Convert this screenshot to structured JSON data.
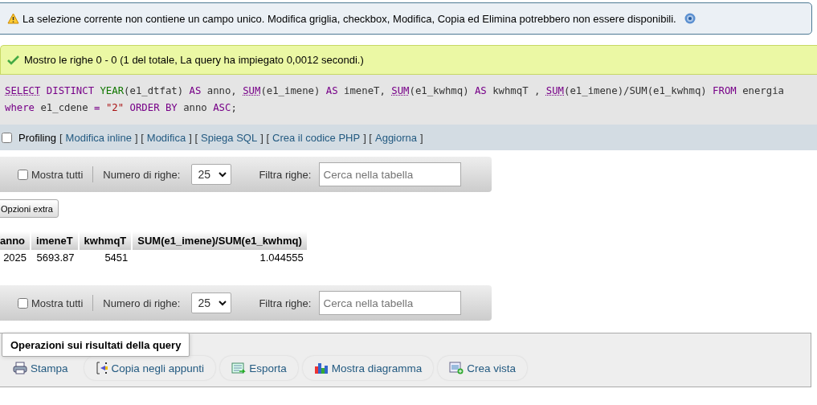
{
  "notice": {
    "text": "La selezione corrente non contiene un campo unico. Modifica griglia, checkbox, Modifica, Copia ed Elimina potrebbero non essere disponibili."
  },
  "success": {
    "text": "Mostro le righe 0 - 0 (1 del totale, La query ha impiegato 0,0012 secondi.)"
  },
  "sql": [
    {
      "kind": "keyword_link",
      "text": "SELECT"
    },
    {
      "kind": "keyword",
      "text": " DISTINCT "
    },
    {
      "kind": "function",
      "text": "YEAR"
    },
    {
      "kind": "plain",
      "text": "(e1_dtfat) "
    },
    {
      "kind": "keyword",
      "text": "AS"
    },
    {
      "kind": "plain",
      "text": " anno, "
    },
    {
      "kind": "function_link",
      "text": "SUM"
    },
    {
      "kind": "plain",
      "text": "(e1_imene) "
    },
    {
      "kind": "keyword",
      "text": "AS"
    },
    {
      "kind": "plain",
      "text": " imeneT, "
    },
    {
      "kind": "function_link",
      "text": "SUM"
    },
    {
      "kind": "plain",
      "text": "(e1_kwhmq) "
    },
    {
      "kind": "keyword",
      "text": "AS"
    },
    {
      "kind": "plain",
      "text": " kwhmqT , "
    },
    {
      "kind": "function_link",
      "text": "SUM"
    },
    {
      "kind": "plain",
      "text": "(e1_imene)/SUM(e1_kwhmq) "
    },
    {
      "kind": "keyword",
      "text": "FROM"
    },
    {
      "kind": "plain",
      "text": " energia "
    },
    {
      "kind": "keyword",
      "text": "where"
    },
    {
      "kind": "plain",
      "text": " e1_cdene "
    },
    {
      "kind": "keyword",
      "text": "= "
    },
    {
      "kind": "string",
      "text": "\"2\" "
    },
    {
      "kind": "keyword",
      "text": "ORDER BY"
    },
    {
      "kind": "plain",
      "text": " anno "
    },
    {
      "kind": "keyword",
      "text": "ASC"
    },
    {
      "kind": "plain",
      "text": ";"
    }
  ],
  "profiling": {
    "label": "Profiling",
    "checked": false,
    "items": [
      {
        "kind": "bracket",
        "text": "["
      },
      {
        "kind": "link",
        "text": "Modifica inline"
      },
      {
        "kind": "bracket",
        "text": "] ["
      },
      {
        "kind": "link",
        "text": "Modifica"
      },
      {
        "kind": "bracket",
        "text": "] ["
      },
      {
        "kind": "link",
        "text": "Spiega SQL"
      },
      {
        "kind": "bracket",
        "text": "] ["
      },
      {
        "kind": "link",
        "text": "Crea il codice PHP"
      },
      {
        "kind": "bracket",
        "text": "] ["
      },
      {
        "kind": "link",
        "text": "Aggiorna"
      },
      {
        "kind": "bracket",
        "text": "]"
      }
    ]
  },
  "navigation": [
    {
      "show_all": "Mostra tutti",
      "show_all_checked": false,
      "rows_label": "Numero di righe:",
      "rows_value": "25",
      "filter_label": "Filtra righe:",
      "filter_placeholder": "Cerca nella tabella"
    }
  ],
  "extra_options": "Opzioni extra",
  "table": {
    "columns": [
      "anno",
      "imeneT",
      "kwhmqT",
      "SUM(e1_imene)/SUM(e1_kwhmq)"
    ],
    "rows": [
      [
        "2025",
        "5693.87",
        "5451",
        "1.044555"
      ]
    ]
  },
  "navigation_bottom": {
    "show_all": "Mostra tutti",
    "show_all_checked": false,
    "rows_label": "Numero di righe:",
    "rows_value": "25",
    "filter_label": "Filtra righe:",
    "filter_placeholder": "Cerca nella tabella"
  },
  "operations": {
    "legend": "Operazioni sui risultati della query",
    "actions": [
      {
        "kind": "print",
        "label": "Stampa"
      },
      {
        "kind": "copy",
        "label": "Copia negli appunti"
      },
      {
        "kind": "export",
        "label": "Esporta"
      },
      {
        "kind": "chart",
        "label": "Mostra diagramma"
      },
      {
        "kind": "view",
        "label": "Crea vista"
      }
    ]
  }
}
